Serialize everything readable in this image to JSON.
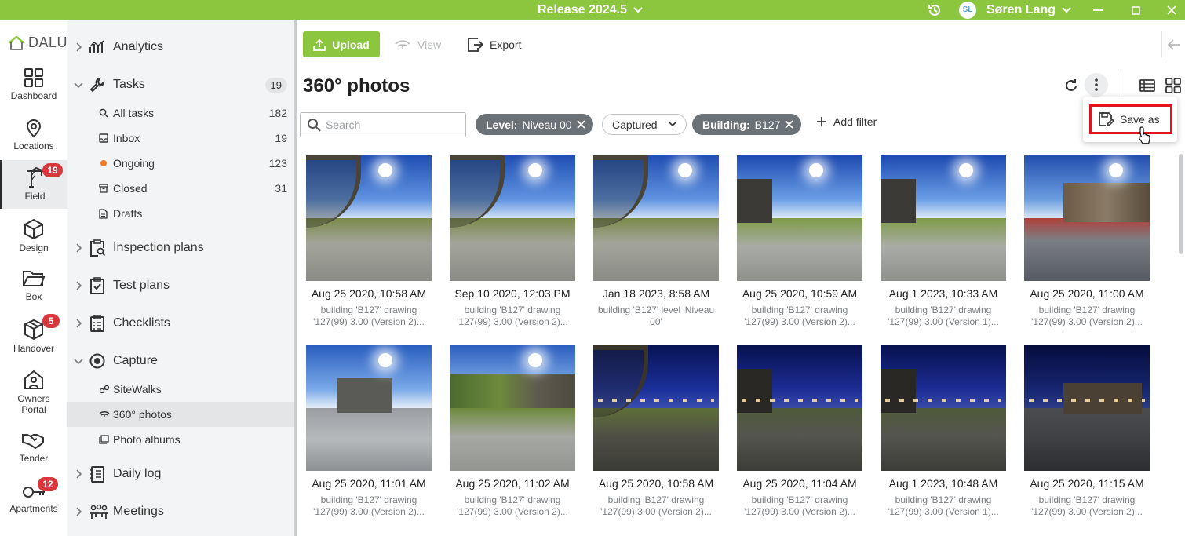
{
  "titlebar": {
    "release": "Release 2024.5",
    "avatar_initials": "SL",
    "user_name": "Søren Lang",
    "accent": "#8cc63f"
  },
  "logo": {
    "text": "DALUX"
  },
  "rail": [
    {
      "label": "Dashboard",
      "icon": "dashboard-icon",
      "badge": ""
    },
    {
      "label": "Locations",
      "icon": "location-pin-icon",
      "badge": ""
    },
    {
      "label": "Field",
      "icon": "crane-icon",
      "badge": "19"
    },
    {
      "label": "Design",
      "icon": "cube-icon",
      "badge": ""
    },
    {
      "label": "Box",
      "icon": "folder-icon",
      "badge": ""
    },
    {
      "label": "Handover",
      "icon": "package-icon",
      "badge": "5"
    },
    {
      "label": "Owners Portal",
      "icon": "house-person-icon",
      "badge": ""
    },
    {
      "label": "Tender",
      "icon": "handshake-icon",
      "badge": ""
    },
    {
      "label": "Apartments",
      "icon": "key-icon",
      "badge": "12"
    }
  ],
  "nav": {
    "analytics": "Analytics",
    "tasks": "Tasks",
    "tasks_count": "19",
    "task_items": [
      {
        "label": "All tasks",
        "count": "182"
      },
      {
        "label": "Inbox",
        "count": "19"
      },
      {
        "label": "Ongoing",
        "count": "123"
      },
      {
        "label": "Closed",
        "count": "31"
      },
      {
        "label": "Drafts",
        "count": ""
      }
    ],
    "inspection_plans": "Inspection plans",
    "test_plans": "Test plans",
    "checklists": "Checklists",
    "capture": "Capture",
    "capture_items": [
      {
        "label": "SiteWalks"
      },
      {
        "label": "360° photos"
      },
      {
        "label": "Photo albums"
      }
    ],
    "daily_log": "Daily log",
    "meetings": "Meetings"
  },
  "toolbar": {
    "upload": "Upload",
    "view": "View",
    "export": "Export"
  },
  "page": {
    "title": "360° photos"
  },
  "filters": {
    "search_placeholder": "Search",
    "level_key": "Level:",
    "level_value": "Niveau 00",
    "captured": "Captured",
    "building_key": "Building:",
    "building_value": "B127",
    "add_filter": "Add filter"
  },
  "menu": {
    "save_as": "Save as"
  },
  "photos": [
    {
      "date": "Aug 25 2020, 10:58 AM",
      "line1": "building 'B127' drawing",
      "line2": "'127(99) 3.00 (Version 2)...",
      "scene": "day-canopy"
    },
    {
      "date": "Sep 10 2020, 12:03 PM",
      "line1": "building 'B127' drawing",
      "line2": "'127(99) 3.00 (Version 2)...",
      "scene": "day-canopy"
    },
    {
      "date": "Jan 18 2023, 8:58 AM",
      "line1": "building 'B127' level 'Niveau",
      "line2": "00'",
      "scene": "day-canopy"
    },
    {
      "date": "Aug 25 2020, 10:59 AM",
      "line1": "building 'B127' drawing",
      "line2": "'127(99) 3.00 (Version 2)...",
      "scene": "day-courtyard"
    },
    {
      "date": "Aug 1 2023, 10:33 AM",
      "line1": "building 'B127' drawing",
      "line2": "'127(99) 3.00 (Version 1)...",
      "scene": "day-courtyard"
    },
    {
      "date": "Aug 25 2020, 11:00 AM",
      "line1": "building 'B127' drawing",
      "line2": "'127(99) 3.00 (Version 2)...",
      "scene": "day-glass"
    },
    {
      "date": "Aug 25 2020, 11:01 AM",
      "line1": "building 'B127' drawing",
      "line2": "'127(99) 3.00 (Version 2)...",
      "scene": "day-lot"
    },
    {
      "date": "Aug 25 2020, 11:02 AM",
      "line1": "building 'B127' drawing",
      "line2": "'127(99) 3.00 (Version 2)...",
      "scene": "day-trees"
    },
    {
      "date": "Aug 25 2020, 10:58 AM",
      "line1": "building 'B127' drawing",
      "line2": "'127(99) 3.00 (Version 2)...",
      "scene": "night-canopy"
    },
    {
      "date": "Aug 25 2020, 11:04 AM",
      "line1": "building 'B127' drawing",
      "line2": "'127(99) 3.00 (Version 2)...",
      "scene": "night-courtyard"
    },
    {
      "date": "Aug 1 2023, 10:48 AM",
      "line1": "building 'B127' drawing",
      "line2": "'127(99) 3.00 (Version 1)...",
      "scene": "night-courtyard"
    },
    {
      "date": "Aug 25 2020, 11:15 AM",
      "line1": "building 'B127' drawing",
      "line2": "'127(99) 3.00 (Version 2)...",
      "scene": "night-street"
    }
  ]
}
